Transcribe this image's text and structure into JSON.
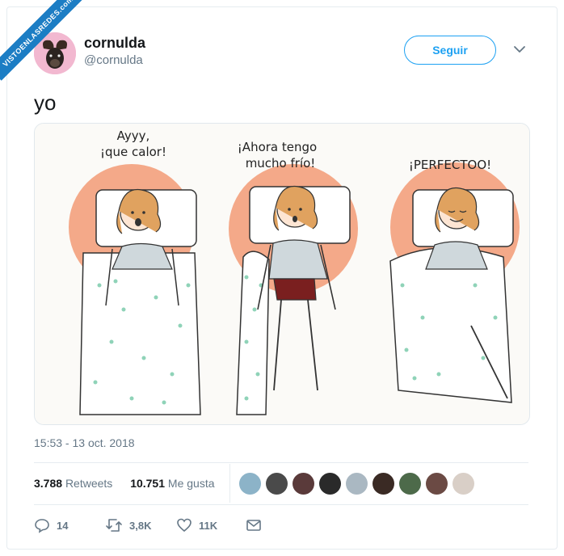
{
  "watermark": "VISTOENLASREDES.com",
  "header": {
    "display_name": "cornulda",
    "handle": "@cornulda",
    "follow_label": "Seguir"
  },
  "tweet": {
    "text": "yo",
    "timestamp": "15:53 - 13 oct. 2018"
  },
  "comic": {
    "panel1_text": [
      "Ayyy,",
      "¡que calor!"
    ],
    "panel2_text": [
      "¡Ahora tengo",
      "mucho frío!"
    ],
    "panel3_text": [
      "¡PERFECTOO!"
    ]
  },
  "stats": {
    "retweets_count": "3.788",
    "retweets_label": "Retweets",
    "likes_count": "10.751",
    "likes_label": "Me gusta"
  },
  "actions": {
    "reply_count": "14",
    "retweet_count": "3,8K",
    "like_count": "11K"
  },
  "colors": {
    "accent": "#1da1f2",
    "text": "#14171a",
    "muted": "#657786",
    "border": "#e6ecf0",
    "comic_halo": "#f4a989"
  }
}
